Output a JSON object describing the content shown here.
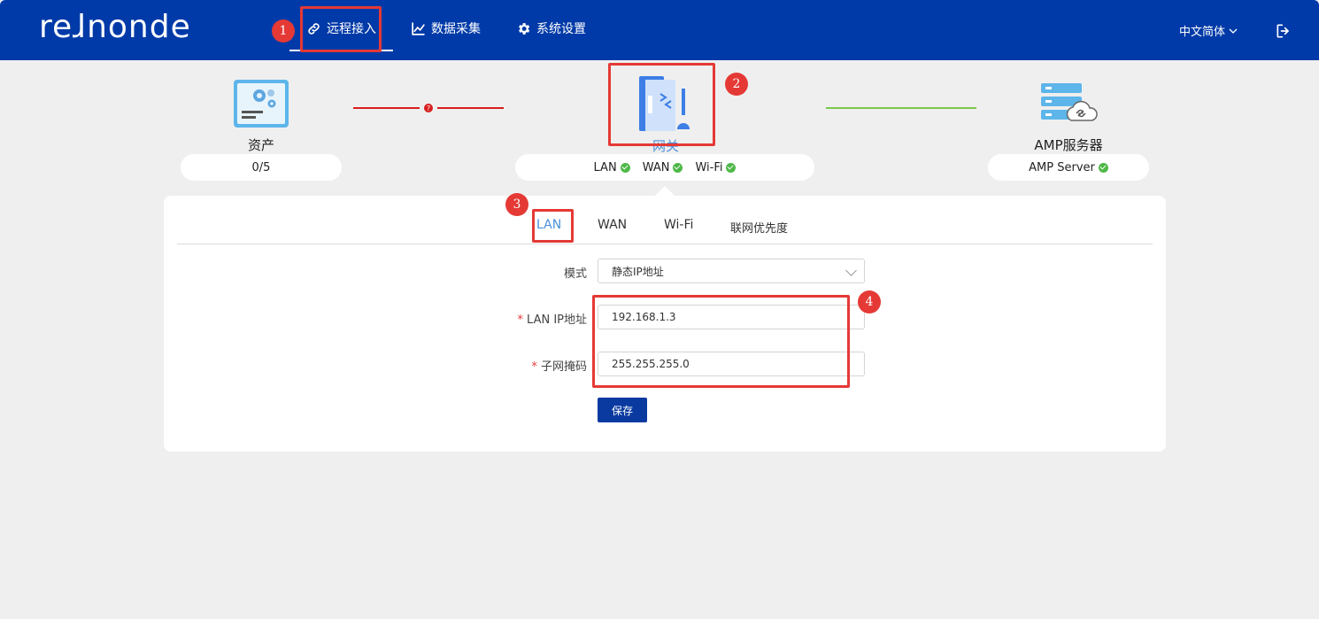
{
  "header": {
    "logo": "reɺnonde",
    "nav": [
      {
        "label": "远程接入",
        "icon": "link-icon"
      },
      {
        "label": "数据采集",
        "icon": "line-chart-icon"
      },
      {
        "label": "系统设置",
        "icon": "gear-icon"
      }
    ],
    "language": "中文简体"
  },
  "markers": [
    "1",
    "2",
    "3",
    "4"
  ],
  "topology": {
    "asset": {
      "label": "资产",
      "count": "0/5"
    },
    "gateway": {
      "label": "网关",
      "lan": "LAN",
      "wan": "WAN",
      "wifi": "Wi-Fi"
    },
    "server": {
      "label": "AMP服务器",
      "status": "AMP Server"
    }
  },
  "tabs": [
    "LAN",
    "WAN",
    "Wi-Fi",
    "联网优先度"
  ],
  "form": {
    "mode_label": "模式",
    "mode_value": "静态IP地址",
    "ip_label": "LAN IP地址",
    "ip_value": "192.168.1.3",
    "mask_label": "子网掩码",
    "mask_value": "255.255.255.0",
    "required_mark": "*",
    "save_label": "保存"
  },
  "colors": {
    "header": "#003aa8",
    "accent_tab": "#4a90d9",
    "ok": "#4fb848",
    "error_link": "#d81e1e",
    "ok_link": "#7cc84a",
    "annotation": "#e53935"
  }
}
